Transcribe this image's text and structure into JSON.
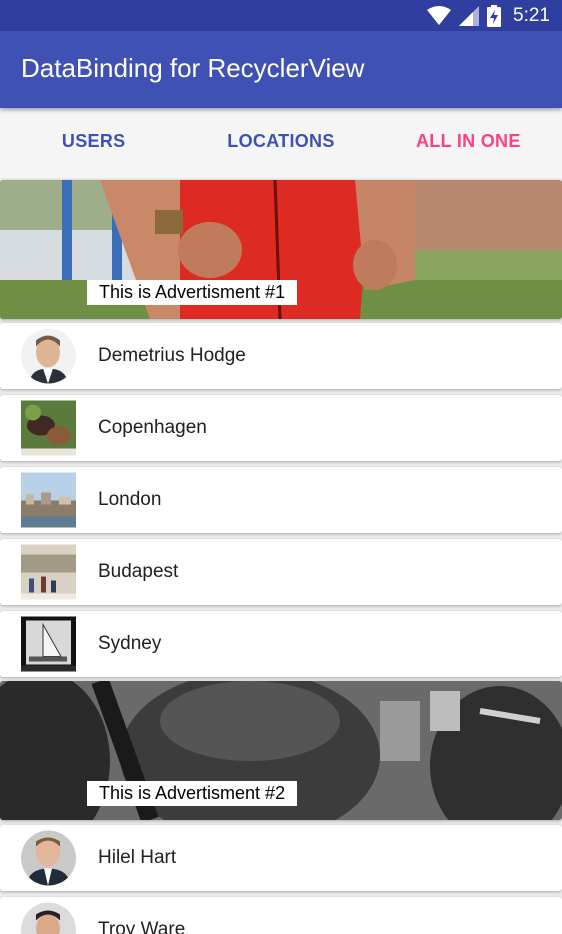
{
  "status": {
    "time": "5:21"
  },
  "app": {
    "title": "DataBinding for RecyclerView"
  },
  "tabs": [
    {
      "label": "USERS"
    },
    {
      "label": "LOCATIONS"
    },
    {
      "label": "ALL IN ONE"
    }
  ],
  "ads": [
    {
      "label": "This is Advertisment #1"
    },
    {
      "label": "This is Advertisment #2"
    }
  ],
  "items": [
    {
      "name": "Demetrius Hodge"
    },
    {
      "name": "Copenhagen"
    },
    {
      "name": "London"
    },
    {
      "name": "Budapest"
    },
    {
      "name": "Sydney"
    },
    {
      "name": "Hilel Hart"
    },
    {
      "name": "Troy Ware"
    }
  ],
  "colors": {
    "primary": "#3f51b5",
    "primary_dark": "#303f9f",
    "accent": "#ff4081"
  }
}
